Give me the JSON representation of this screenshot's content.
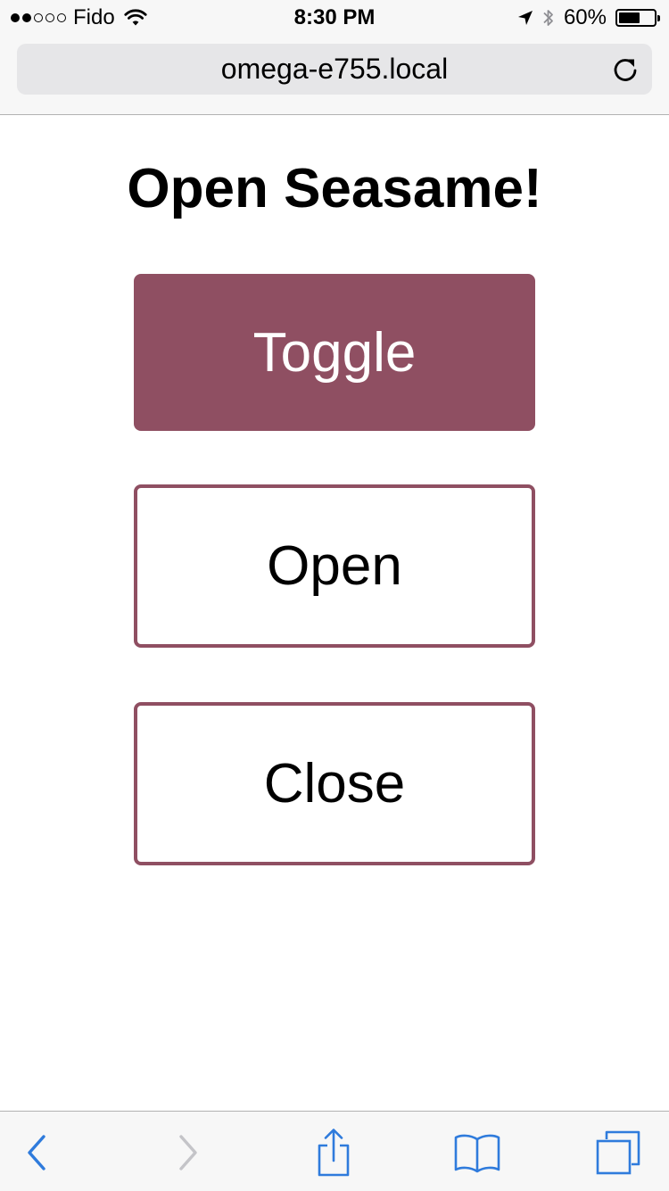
{
  "status_bar": {
    "carrier": "Fido",
    "signal_filled": 2,
    "signal_total": 5,
    "time": "8:30 PM",
    "battery_percent": "60%",
    "battery_level": 0.6
  },
  "browser": {
    "url": "omega-e755.local"
  },
  "page": {
    "title": "Open Seasame!",
    "buttons": {
      "toggle": "Toggle",
      "open": "Open",
      "close": "Close"
    }
  },
  "colors": {
    "accent": "#8f4f62",
    "ios_blue": "#2f7bdc",
    "disabled_gray": "#c4c4c8"
  },
  "toolbar": {
    "icons": [
      "back-icon",
      "forward-icon",
      "share-icon",
      "bookmarks-icon",
      "tabs-icon"
    ]
  }
}
